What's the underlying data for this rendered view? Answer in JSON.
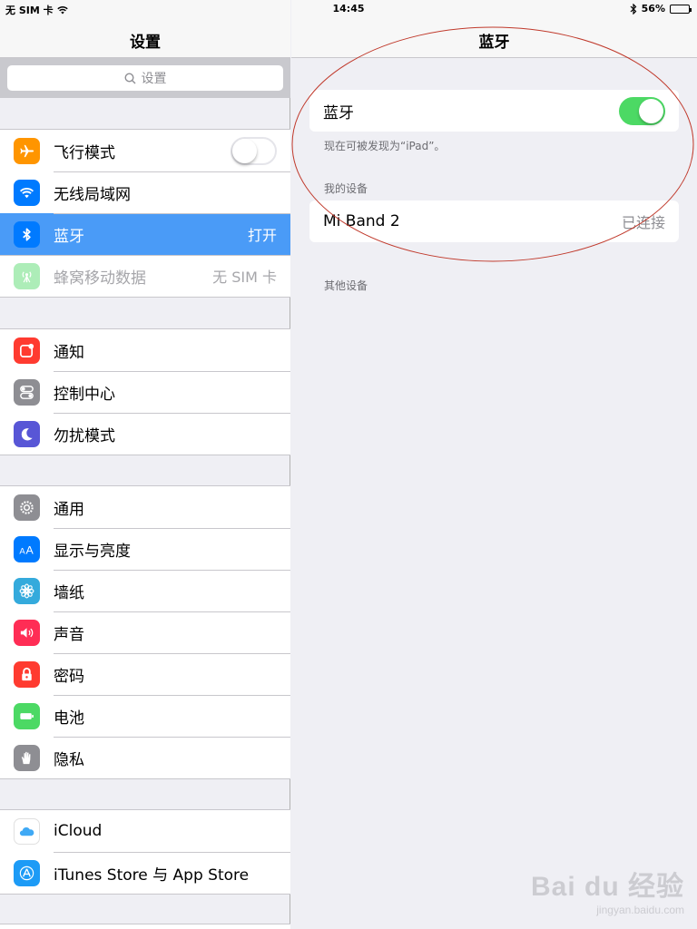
{
  "status_bar": {
    "carrier": "无 SIM 卡",
    "time": "14:45",
    "battery_percent": "56%",
    "battery_level": 0.56
  },
  "master": {
    "title": "设置",
    "search_placeholder": "设置",
    "group1": [
      {
        "label": "飞行模式",
        "icon": "airplane-icon",
        "color": "#ff9500",
        "toggle": "off"
      },
      {
        "label": "无线局域网",
        "icon": "wifi-icon",
        "color": "#007aff",
        "value": ""
      },
      {
        "label": "蓝牙",
        "icon": "bluetooth-icon",
        "color": "#007aff",
        "value": "打开",
        "selected": true
      },
      {
        "label": "蜂窝移动数据",
        "icon": "cellular-icon",
        "color": "#4cd964",
        "value": "无 SIM 卡",
        "disabled": true
      }
    ],
    "group2": [
      {
        "label": "通知",
        "icon": "notifications-icon",
        "color": "#ff3b30"
      },
      {
        "label": "控制中心",
        "icon": "control-center-icon",
        "color": "#8e8e93"
      },
      {
        "label": "勿扰模式",
        "icon": "moon-icon",
        "color": "#5856d6"
      }
    ],
    "group3": [
      {
        "label": "通用",
        "icon": "gear-icon",
        "color": "#8e8e93"
      },
      {
        "label": "显示与亮度",
        "icon": "display-icon",
        "color": "#007aff"
      },
      {
        "label": "墙纸",
        "icon": "wallpaper-icon",
        "color": "#34aadc"
      },
      {
        "label": "声音",
        "icon": "speaker-icon",
        "color": "#ff2d55"
      },
      {
        "label": "密码",
        "icon": "lock-icon",
        "color": "#ff3b30"
      },
      {
        "label": "电池",
        "icon": "battery-icon",
        "color": "#4cd964"
      },
      {
        "label": "隐私",
        "icon": "hand-icon",
        "color": "#8e8e93"
      }
    ],
    "group4": [
      {
        "label": "iCloud",
        "icon": "icloud-icon",
        "color": "#ffffff"
      },
      {
        "label": "iTunes Store 与 App Store",
        "icon": "app-store-icon",
        "color": "#1d9bf6"
      }
    ]
  },
  "detail": {
    "title": "蓝牙",
    "bluetooth_label": "蓝牙",
    "bluetooth_toggle": "on",
    "discoverable_text": "现在可被发现为“iPad”。",
    "my_devices_header": "我的设备",
    "devices": [
      {
        "name": "Mi Band 2",
        "status": "已连接"
      }
    ],
    "other_devices_header": "其他设备"
  },
  "watermark": {
    "main": "Bai du 经验",
    "sub": "jingyan.baidu.com"
  },
  "colors": {
    "selected_row": "#4a9bf7",
    "toggle_on": "#4cd964",
    "annotation_ellipse": "#c0392b"
  }
}
